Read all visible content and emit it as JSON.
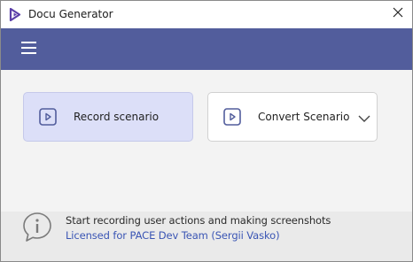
{
  "window": {
    "title": "Docu Generator",
    "app_icon": "docu-generator-logo",
    "close_icon": "close-icon"
  },
  "navbar": {
    "menu_icon": "hamburger-menu-icon",
    "background_color": "#525d9c"
  },
  "actions": {
    "record": {
      "label": "Record scenario",
      "icon": "play-icon",
      "selected": true
    },
    "convert": {
      "label": "Convert Scenario",
      "icon": "play-icon",
      "dropdown_icon": "chevron-down-icon"
    }
  },
  "footer": {
    "info_icon": "info-icon",
    "status_text": "Start recording user actions and making screenshots",
    "license_link": "Licensed for PACE Dev Team (Sergii Vasko)"
  },
  "colors": {
    "accent": "#525d9c",
    "selected_card": "#dcdff8",
    "link": "#3a55b4"
  }
}
